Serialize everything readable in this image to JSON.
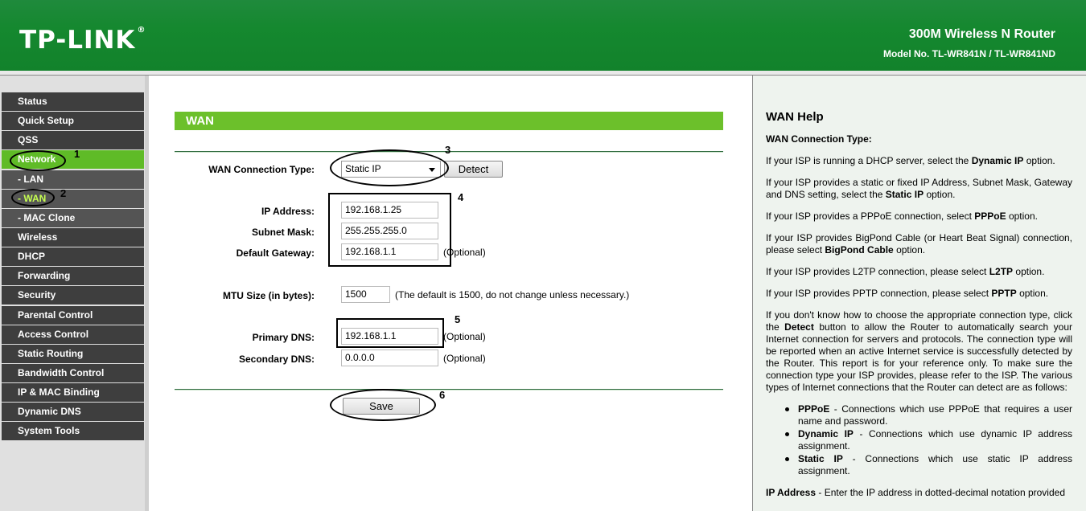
{
  "header": {
    "logo": "TP-LINK",
    "logo_mark": "®",
    "product": "300M Wireless N Router",
    "model": "Model No. TL-WR841N / TL-WR841ND"
  },
  "menu": [
    {
      "label": "Status"
    },
    {
      "label": "Quick Setup"
    },
    {
      "label": "QSS"
    },
    {
      "label": "Network"
    },
    {
      "label": "- LAN"
    },
    {
      "label": "- WAN"
    },
    {
      "label": "- MAC Clone"
    },
    {
      "label": "Wireless"
    },
    {
      "label": "DHCP"
    },
    {
      "label": "Forwarding"
    },
    {
      "label": "Security"
    },
    {
      "label": "Parental Control"
    },
    {
      "label": "Access Control"
    },
    {
      "label": "Static Routing"
    },
    {
      "label": "Bandwidth Control"
    },
    {
      "label": "IP & MAC Binding"
    },
    {
      "label": "Dynamic DNS"
    },
    {
      "label": "System Tools"
    }
  ],
  "main": {
    "section_title": "WAN",
    "wan_type_label": "WAN Connection Type:",
    "wan_type_value": "Static IP",
    "detect_label": "Detect",
    "ip_label": "IP Address:",
    "ip_value": "192.168.1.25",
    "mask_label": "Subnet Mask:",
    "mask_value": "255.255.255.0",
    "gateway_label": "Default Gateway:",
    "gateway_value": "192.168.1.1",
    "optional": "(Optional)",
    "mtu_label": "MTU Size (in bytes):",
    "mtu_value": "1500",
    "mtu_note": "(The default is 1500, do not change unless necessary.)",
    "pdns_label": "Primary DNS:",
    "pdns_value": "192.168.1.1",
    "sdns_label": "Secondary DNS:",
    "sdns_value": "0.0.0.0",
    "save_label": "Save"
  },
  "annotations": [
    "1",
    "2",
    "3",
    "4",
    "5",
    "6"
  ],
  "help": {
    "title": "WAN Help",
    "subtitle": "WAN Connection Type:",
    "p1a": "If your ISP is running a DHCP server, select the ",
    "p1b": "Dynamic IP",
    "p1c": " option.",
    "p2a": "If your ISP provides a static or fixed IP Address, Subnet Mask, Gateway and DNS setting, select the ",
    "p2b": "Static IP",
    "p2c": " option.",
    "p3a": "If your ISP provides a PPPoE connection, select ",
    "p3b": "PPPoE",
    "p3c": " option.",
    "p4a": "If your ISP provides BigPond Cable (or Heart Beat Signal) connection, please select ",
    "p4b": "BigPond Cable",
    "p4c": " option.",
    "p5a": "If your ISP provides L2TP connection, please select ",
    "p5b": "L2TP",
    "p5c": " option.",
    "p6a": "If your ISP provides PPTP connection, please select ",
    "p6b": "PPTP",
    "p6c": " option.",
    "p7a": "If you don't know how to choose the appropriate connection type, click the ",
    "p7b": "Detect",
    "p7c": " button to allow the Router to automatically search your Internet connection for servers and protocols. The connection type will be reported when an active Internet service is successfully detected by the Router. This report is for your reference only. To make sure the connection type your ISP provides, please refer to the ISP. The various types of Internet connections that the Router can detect are as follows:",
    "li1b": "PPPoE",
    "li1t": " - Connections which use PPPoE that requires a user name and password.",
    "li2b": "Dynamic IP",
    "li2t": " - Connections which use dynamic IP address assignment.",
    "li3b": "Static IP",
    "li3t": " - Connections which use static IP address assignment.",
    "p8b": "IP Address",
    "p8t": " - Enter the IP address in dotted-decimal notation provided"
  }
}
